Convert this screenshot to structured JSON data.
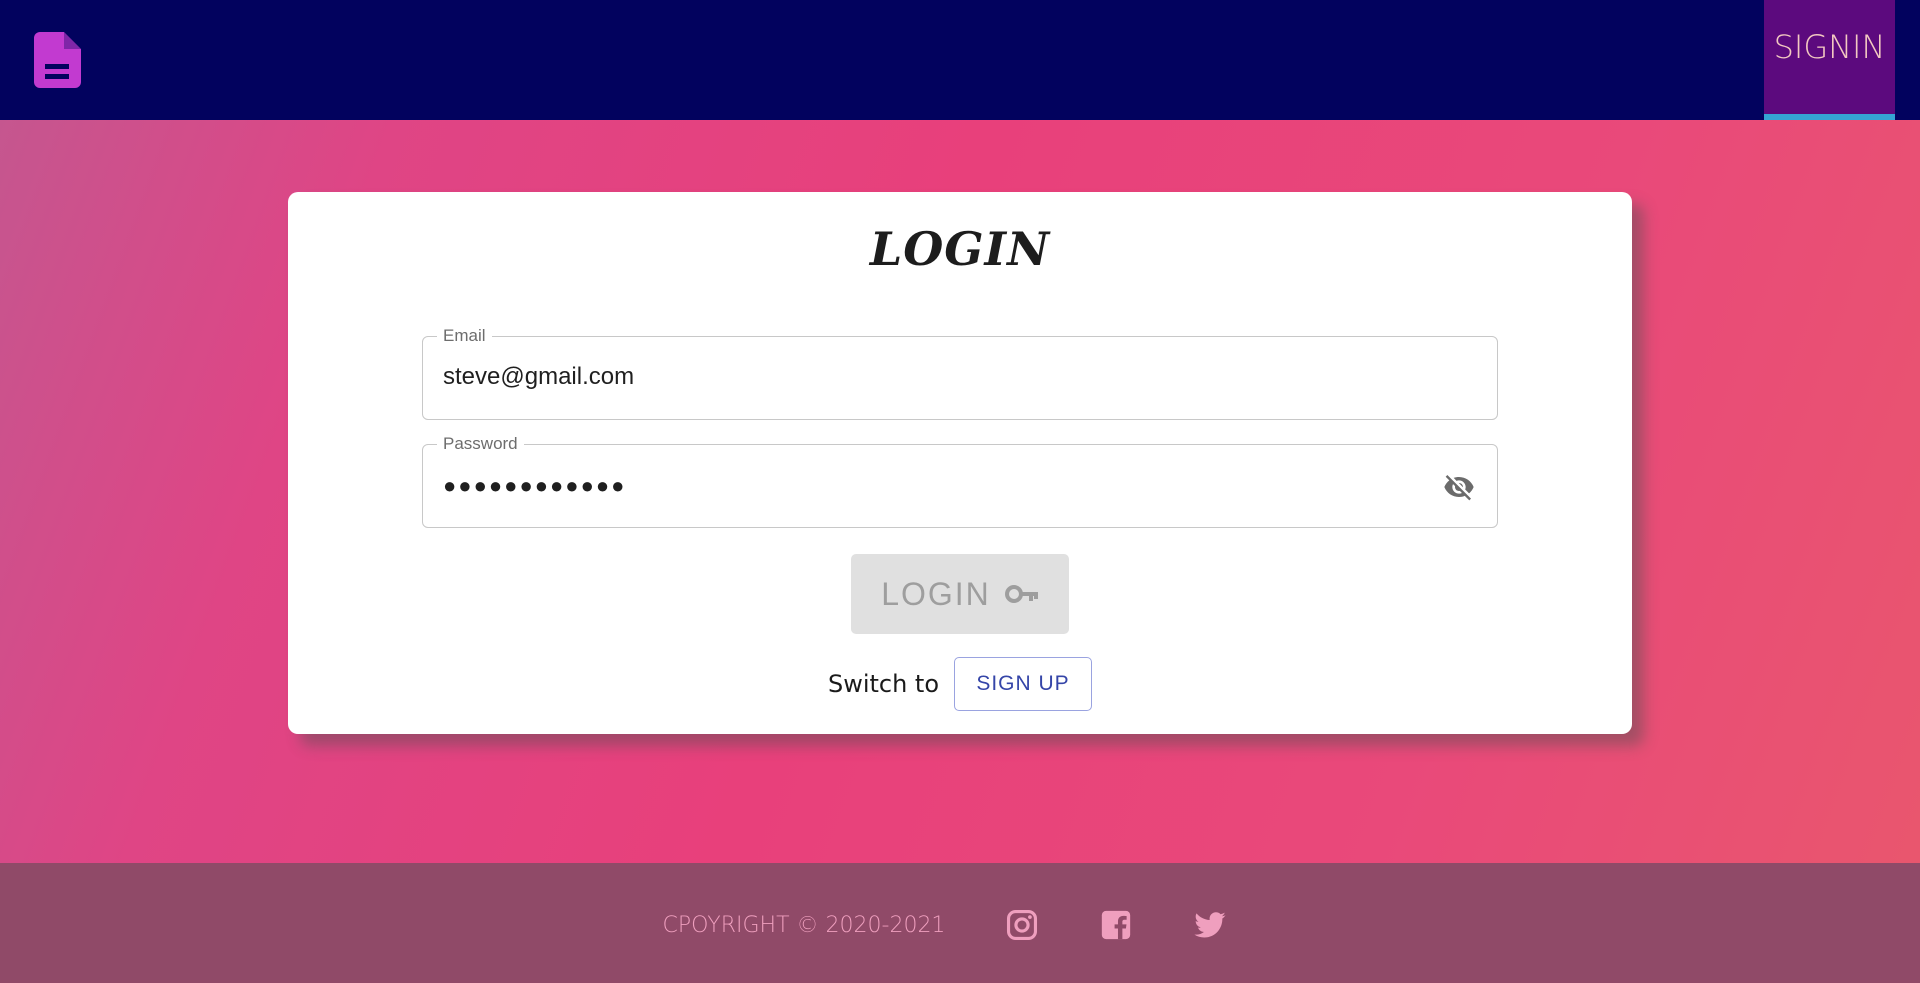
{
  "header": {
    "logo_icon": "document-icon",
    "signin_label": "SIGNIN"
  },
  "card": {
    "title": "LOGIN",
    "email": {
      "label": "Email",
      "value": "steve@gmail.com"
    },
    "password": {
      "label": "Password",
      "masked_value": "●●●●●●●●●●●●",
      "toggle_icon": "eye-off-icon"
    },
    "login_button": {
      "label": "LOGIN",
      "icon": "key-icon"
    },
    "switch_text": "Switch to",
    "signup_label": "SIGN UP"
  },
  "footer": {
    "copyright": "CPOYRIGHT © 2020-2021",
    "social": [
      "instagram-icon",
      "facebook-icon",
      "twitter-icon"
    ]
  },
  "colors": {
    "header_bg": "#02025e",
    "signin_tab_bg": "#5c0a7e",
    "tab_indicator": "#35a4d3",
    "logo": "#c23ad0",
    "footer_bg": "#904a68",
    "footer_text": "#ef9fbe",
    "signup_text": "#3545a8"
  }
}
